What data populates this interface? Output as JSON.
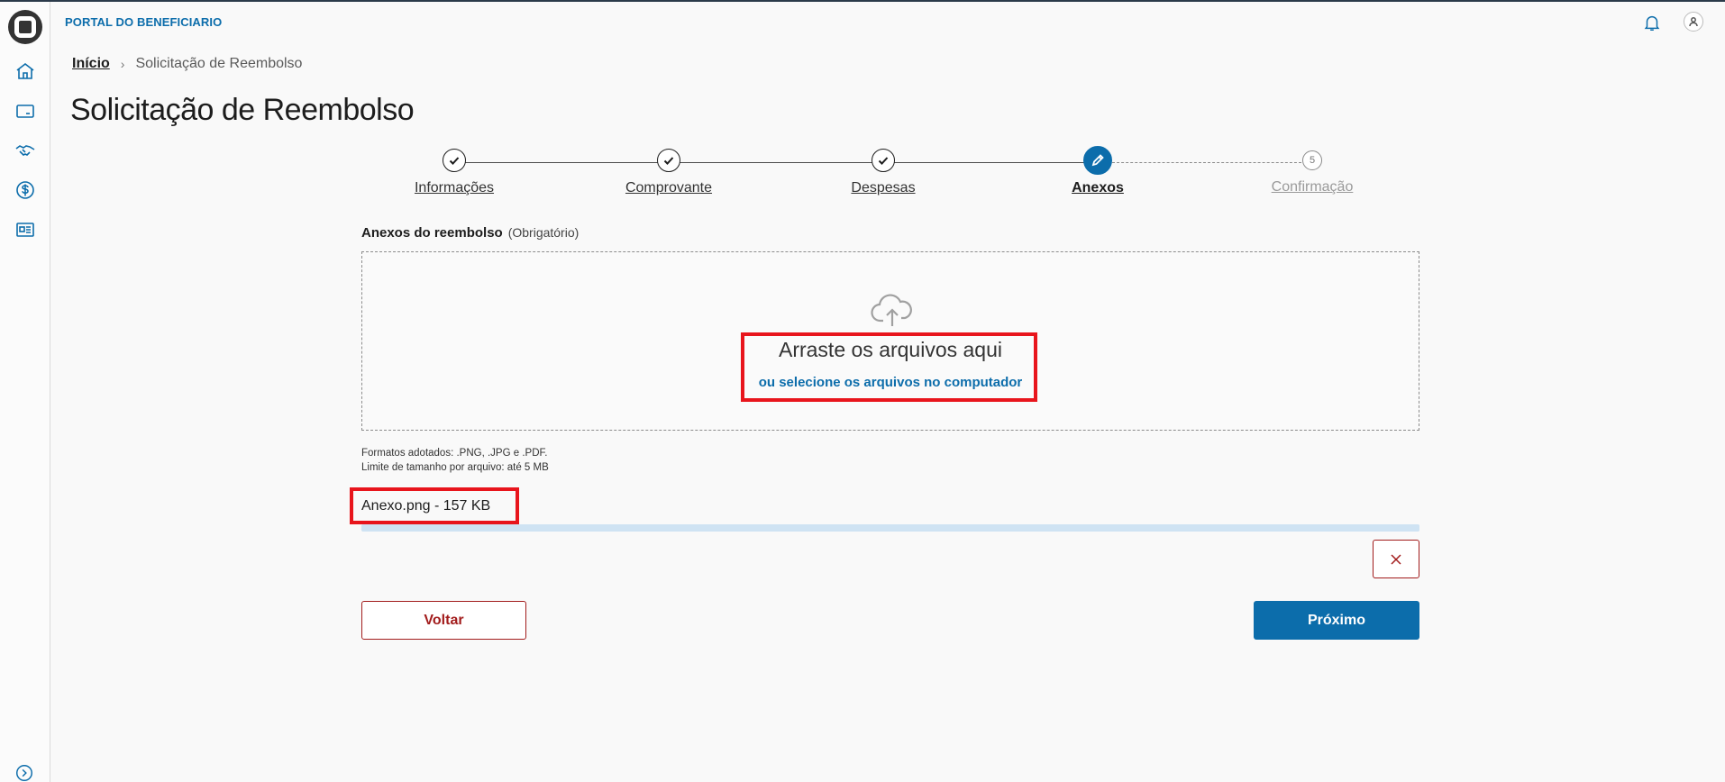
{
  "header": {
    "portal_title": "PORTAL DO BENEFICIARIO"
  },
  "sidebar": {
    "items": [
      {
        "icon": "home-icon"
      },
      {
        "icon": "card-icon"
      },
      {
        "icon": "handshake-icon"
      },
      {
        "icon": "dollar-icon"
      },
      {
        "icon": "id-card-icon"
      }
    ],
    "expand_icon": "expand-icon"
  },
  "breadcrumb": {
    "home": "Início",
    "current": "Solicitação de Reembolso"
  },
  "page_title": "Solicitação de Reembolso",
  "stepper": {
    "steps": [
      {
        "label": "Informações",
        "state": "done"
      },
      {
        "label": "Comprovante",
        "state": "done"
      },
      {
        "label": "Despesas",
        "state": "done"
      },
      {
        "label": "Anexos",
        "state": "current"
      },
      {
        "label": "Confirmação",
        "state": "pending",
        "number": "5"
      }
    ]
  },
  "upload": {
    "section_label": "Anexos do reembolso",
    "required_label": "(Obrigatório)",
    "drag_text": "Arraste os arquivos aqui",
    "select_link": "ou selecione os arquivos no computador",
    "formats_line1": "Formatos adotados: .PNG, .JPG e .PDF.",
    "formats_line2": "Limite de tamanho por arquivo: até 5 MB"
  },
  "file": {
    "name": "Anexo.png - 157 KB",
    "progress": 1.0
  },
  "actions": {
    "back_label": "Voltar",
    "next_label": "Próximo"
  },
  "colors": {
    "accent": "#0c6dab",
    "danger": "#a21c1c",
    "highlight": "#e8151c"
  }
}
